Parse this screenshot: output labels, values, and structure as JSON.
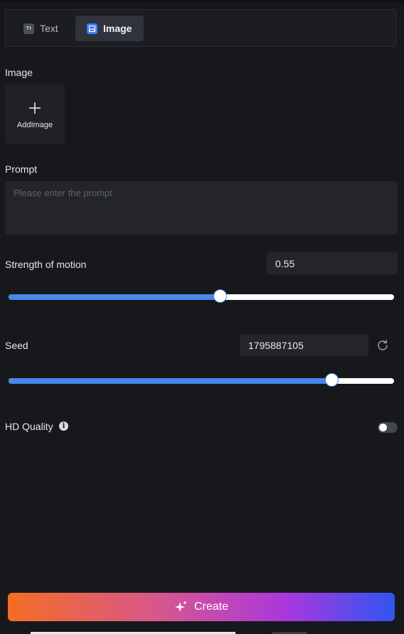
{
  "tabs": [
    {
      "label": "Text",
      "icon": "text-icon",
      "active": false
    },
    {
      "label": "Image",
      "icon": "image-icon",
      "active": true
    }
  ],
  "image_section": {
    "label": "Image",
    "add_label": "AddImage",
    "add_icon": "plus-icon"
  },
  "prompt": {
    "label": "Prompt",
    "placeholder": "Please enter the prompt",
    "value": ""
  },
  "strength": {
    "label": "Strength of motion",
    "value": "0.55",
    "fraction": 0.55
  },
  "seed": {
    "label": "Seed",
    "value": "1795887105",
    "fraction": 0.84,
    "refresh_icon": "refresh-icon"
  },
  "hd_quality": {
    "label": "HD Quality",
    "info_icon": "info-icon",
    "enabled": false
  },
  "create_button": {
    "label": "Create",
    "icon": "sparkle-icon"
  },
  "colors": {
    "accent": "#4a86e8",
    "background": "#17181c",
    "gradient_start": "#f46d23",
    "gradient_end": "#2f55f0"
  }
}
